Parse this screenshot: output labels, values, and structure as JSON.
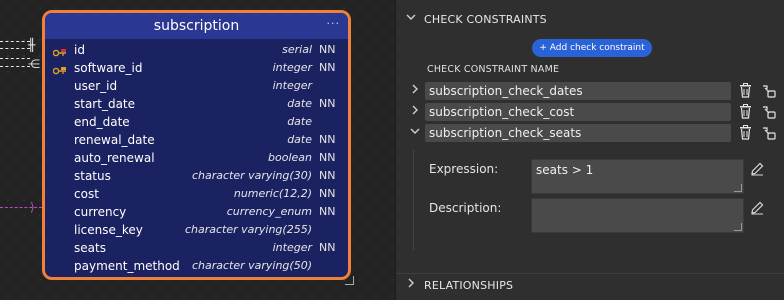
{
  "table": {
    "name": "subscription",
    "menu_glyph": "···",
    "columns": [
      {
        "name": "id",
        "type": "serial",
        "nn": "NN",
        "key": "pk"
      },
      {
        "name": "software_id",
        "type": "integer",
        "nn": "NN",
        "key": "fk"
      },
      {
        "name": "user_id",
        "type": "integer",
        "nn": "",
        "key": ""
      },
      {
        "name": "start_date",
        "type": "date",
        "nn": "NN",
        "key": ""
      },
      {
        "name": "end_date",
        "type": "date",
        "nn": "",
        "key": ""
      },
      {
        "name": "renewal_date",
        "type": "date",
        "nn": "NN",
        "key": ""
      },
      {
        "name": "auto_renewal",
        "type": "boolean",
        "nn": "NN",
        "key": ""
      },
      {
        "name": "status",
        "type": "character varying(30)",
        "nn": "NN",
        "key": ""
      },
      {
        "name": "cost",
        "type": "numeric(12,2)",
        "nn": "NN",
        "key": ""
      },
      {
        "name": "currency",
        "type": "currency_enum",
        "nn": "NN",
        "key": ""
      },
      {
        "name": "license_key",
        "type": "character varying(255)",
        "nn": "",
        "key": ""
      },
      {
        "name": "seats",
        "type": "integer",
        "nn": "NN",
        "key": ""
      },
      {
        "name": "payment_method",
        "type": "character varying(50)",
        "nn": "",
        "key": ""
      }
    ]
  },
  "panel": {
    "check_section_title": "CHECK CONSTRAINTS",
    "add_button_label": "+ Add check constraint",
    "column_header": "CHECK CONSTRAINT NAME",
    "constraints": [
      {
        "name": "subscription_check_dates",
        "expanded": false
      },
      {
        "name": "subscription_check_cost",
        "expanded": false
      },
      {
        "name": "subscription_check_seats",
        "expanded": true
      }
    ],
    "expression_label": "Expression:",
    "expression_value": "seats > 1",
    "description_label": "Description:",
    "description_value": "",
    "relationships_title": "RELATIONSHIPS"
  },
  "colors": {
    "table_border": "#f0803a",
    "table_body": "#1b2262",
    "table_header": "#2a3893",
    "add_button": "#2a63d8",
    "pk_key": "#e0a020",
    "fk_key": "#d03030",
    "fk_line": "#c048c8"
  },
  "icons": [
    "chevron-down-icon",
    "chevron-right-icon",
    "trash-icon",
    "duplicate-icon",
    "pencil-icon",
    "key-icon"
  ]
}
